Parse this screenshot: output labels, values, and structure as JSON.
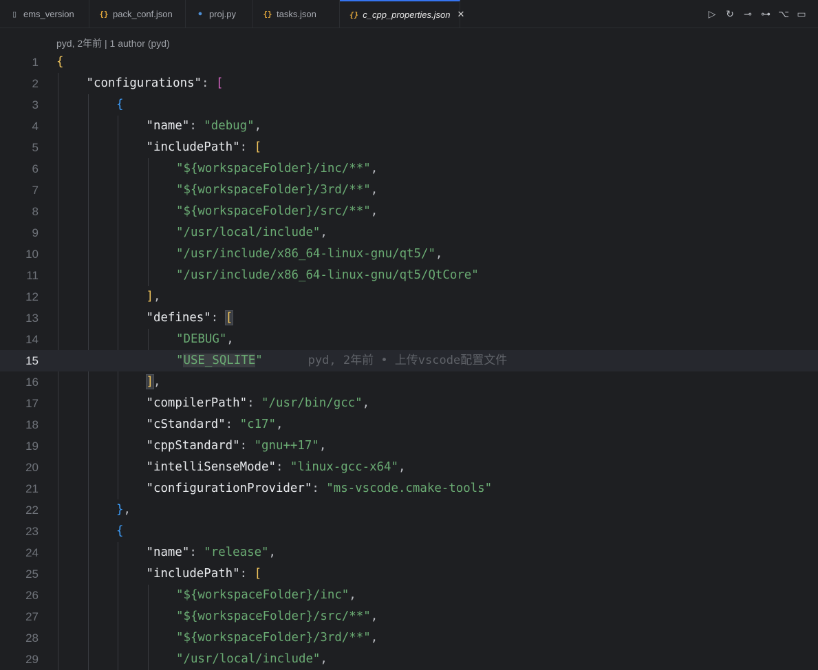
{
  "tabs": [
    {
      "label": "ems_version",
      "icon": "file-icon"
    },
    {
      "label": "pack_conf.json",
      "icon": "json-icon"
    },
    {
      "label": "proj.py",
      "icon": "python-icon"
    },
    {
      "label": "tasks.json",
      "icon": "json-icon"
    },
    {
      "label": "c_cpp_properties.json",
      "icon": "json-icon",
      "active": true
    }
  ],
  "toolbar": [
    {
      "name": "run-icon",
      "glyph": "▷"
    },
    {
      "name": "open-changes-icon",
      "glyph": "↻"
    },
    {
      "name": "previous-change-icon",
      "glyph": "⊸"
    },
    {
      "name": "next-change-icon",
      "glyph": "⊶"
    },
    {
      "name": "git-graph-icon",
      "glyph": "⌥"
    },
    {
      "name": "split-editor-icon",
      "glyph": "▭"
    }
  ],
  "tab_close_glyph": "✕",
  "blame_header": "pyd, 2年前 | 1 author (pyd)",
  "inline_blame": "pyd, 2年前 • 上传vscode配置文件",
  "current_line": 15,
  "colors": {
    "background": "#1e1f22",
    "string": "#6aab73",
    "key": "#e8eaed",
    "bracket_gold": "#f2c55c",
    "bracket_pink": "#d663c2",
    "bracket_blue": "#3ea0ff"
  },
  "lines": [
    {
      "n": "1",
      "indent": 0,
      "tokens": [
        {
          "t": "{",
          "c": "b1"
        }
      ]
    },
    {
      "n": "2",
      "indent": 1,
      "tokens": [
        {
          "t": "\"configurations\"",
          "c": "k"
        },
        {
          "t": ": ",
          "c": "p"
        },
        {
          "t": "[",
          "c": "b2"
        }
      ]
    },
    {
      "n": "3",
      "indent": 2,
      "tokens": [
        {
          "t": "{",
          "c": "b3"
        }
      ]
    },
    {
      "n": "4",
      "indent": 3,
      "tokens": [
        {
          "t": "\"name\"",
          "c": "k"
        },
        {
          "t": ": ",
          "c": "p"
        },
        {
          "t": "\"debug\"",
          "c": "s"
        },
        {
          "t": ",",
          "c": "p"
        }
      ]
    },
    {
      "n": "5",
      "indent": 3,
      "tokens": [
        {
          "t": "\"includePath\"",
          "c": "k"
        },
        {
          "t": ": ",
          "c": "p"
        },
        {
          "t": "[",
          "c": "b1"
        }
      ]
    },
    {
      "n": "6",
      "indent": 4,
      "tokens": [
        {
          "t": "\"${workspaceFolder}/inc/**\"",
          "c": "s"
        },
        {
          "t": ",",
          "c": "p"
        }
      ]
    },
    {
      "n": "7",
      "indent": 4,
      "tokens": [
        {
          "t": "\"${workspaceFolder}/3rd/**\"",
          "c": "s"
        },
        {
          "t": ",",
          "c": "p"
        }
      ]
    },
    {
      "n": "8",
      "indent": 4,
      "tokens": [
        {
          "t": "\"${workspaceFolder}/src/**\"",
          "c": "s"
        },
        {
          "t": ",",
          "c": "p"
        }
      ]
    },
    {
      "n": "9",
      "indent": 4,
      "tokens": [
        {
          "t": "\"/usr/local/include\"",
          "c": "s"
        },
        {
          "t": ",",
          "c": "p"
        }
      ]
    },
    {
      "n": "10",
      "indent": 4,
      "tokens": [
        {
          "t": "\"/usr/include/x86_64-linux-gnu/qt5/\"",
          "c": "s"
        },
        {
          "t": ",",
          "c": "p"
        }
      ]
    },
    {
      "n": "11",
      "indent": 4,
      "tokens": [
        {
          "t": "\"/usr/include/x86_64-linux-gnu/qt5/QtCore\"",
          "c": "s"
        }
      ]
    },
    {
      "n": "12",
      "indent": 3,
      "tokens": [
        {
          "t": "]",
          "c": "b1"
        },
        {
          "t": ",",
          "c": "p"
        }
      ]
    },
    {
      "n": "13",
      "indent": 3,
      "tokens": [
        {
          "t": "\"defines\"",
          "c": "k"
        },
        {
          "t": ": ",
          "c": "p"
        },
        {
          "t": "[",
          "c": "b1 bm"
        }
      ]
    },
    {
      "n": "14",
      "indent": 4,
      "tokens": [
        {
          "t": "\"DEBUG\"",
          "c": "s"
        },
        {
          "t": ",",
          "c": "p"
        }
      ]
    },
    {
      "n": "15",
      "indent": 4,
      "tokens": [
        {
          "t": "\"",
          "c": "s"
        },
        {
          "t": "USE_SQLITE",
          "c": "s hl"
        },
        {
          "t": "\"",
          "c": "s"
        }
      ]
    },
    {
      "n": "16",
      "indent": 3,
      "tokens": [
        {
          "t": "]",
          "c": "b1 bm"
        },
        {
          "t": ",",
          "c": "p"
        }
      ]
    },
    {
      "n": "17",
      "indent": 3,
      "tokens": [
        {
          "t": "\"compilerPath\"",
          "c": "k"
        },
        {
          "t": ": ",
          "c": "p"
        },
        {
          "t": "\"/usr/bin/gcc\"",
          "c": "s"
        },
        {
          "t": ",",
          "c": "p"
        }
      ]
    },
    {
      "n": "18",
      "indent": 3,
      "tokens": [
        {
          "t": "\"cStandard\"",
          "c": "k"
        },
        {
          "t": ": ",
          "c": "p"
        },
        {
          "t": "\"c17\"",
          "c": "s"
        },
        {
          "t": ",",
          "c": "p"
        }
      ]
    },
    {
      "n": "19",
      "indent": 3,
      "tokens": [
        {
          "t": "\"cppStandard\"",
          "c": "k"
        },
        {
          "t": ": ",
          "c": "p"
        },
        {
          "t": "\"gnu++17\"",
          "c": "s"
        },
        {
          "t": ",",
          "c": "p"
        }
      ]
    },
    {
      "n": "20",
      "indent": 3,
      "tokens": [
        {
          "t": "\"intelliSenseMode\"",
          "c": "k"
        },
        {
          "t": ": ",
          "c": "p"
        },
        {
          "t": "\"linux-gcc-x64\"",
          "c": "s"
        },
        {
          "t": ",",
          "c": "p"
        }
      ]
    },
    {
      "n": "21",
      "indent": 3,
      "tokens": [
        {
          "t": "\"configurationProvider\"",
          "c": "k"
        },
        {
          "t": ": ",
          "c": "p"
        },
        {
          "t": "\"ms-vscode.cmake-tools\"",
          "c": "s"
        }
      ]
    },
    {
      "n": "22",
      "indent": 2,
      "tokens": [
        {
          "t": "}",
          "c": "b3"
        },
        {
          "t": ",",
          "c": "p"
        }
      ]
    },
    {
      "n": "23",
      "indent": 2,
      "tokens": [
        {
          "t": "{",
          "c": "b3"
        }
      ]
    },
    {
      "n": "24",
      "indent": 3,
      "tokens": [
        {
          "t": "\"name\"",
          "c": "k"
        },
        {
          "t": ": ",
          "c": "p"
        },
        {
          "t": "\"release\"",
          "c": "s"
        },
        {
          "t": ",",
          "c": "p"
        }
      ]
    },
    {
      "n": "25",
      "indent": 3,
      "tokens": [
        {
          "t": "\"includePath\"",
          "c": "k"
        },
        {
          "t": ": ",
          "c": "p"
        },
        {
          "t": "[",
          "c": "b1"
        }
      ]
    },
    {
      "n": "26",
      "indent": 4,
      "tokens": [
        {
          "t": "\"${workspaceFolder}/inc\"",
          "c": "s"
        },
        {
          "t": ",",
          "c": "p"
        }
      ]
    },
    {
      "n": "27",
      "indent": 4,
      "tokens": [
        {
          "t": "\"${workspaceFolder}/src/**\"",
          "c": "s"
        },
        {
          "t": ",",
          "c": "p"
        }
      ]
    },
    {
      "n": "28",
      "indent": 4,
      "tokens": [
        {
          "t": "\"${workspaceFolder}/3rd/**\"",
          "c": "s"
        },
        {
          "t": ",",
          "c": "p"
        }
      ]
    },
    {
      "n": "29",
      "indent": 4,
      "tokens": [
        {
          "t": "\"/usr/local/include\"",
          "c": "s"
        },
        {
          "t": ",",
          "c": "p"
        }
      ]
    }
  ]
}
